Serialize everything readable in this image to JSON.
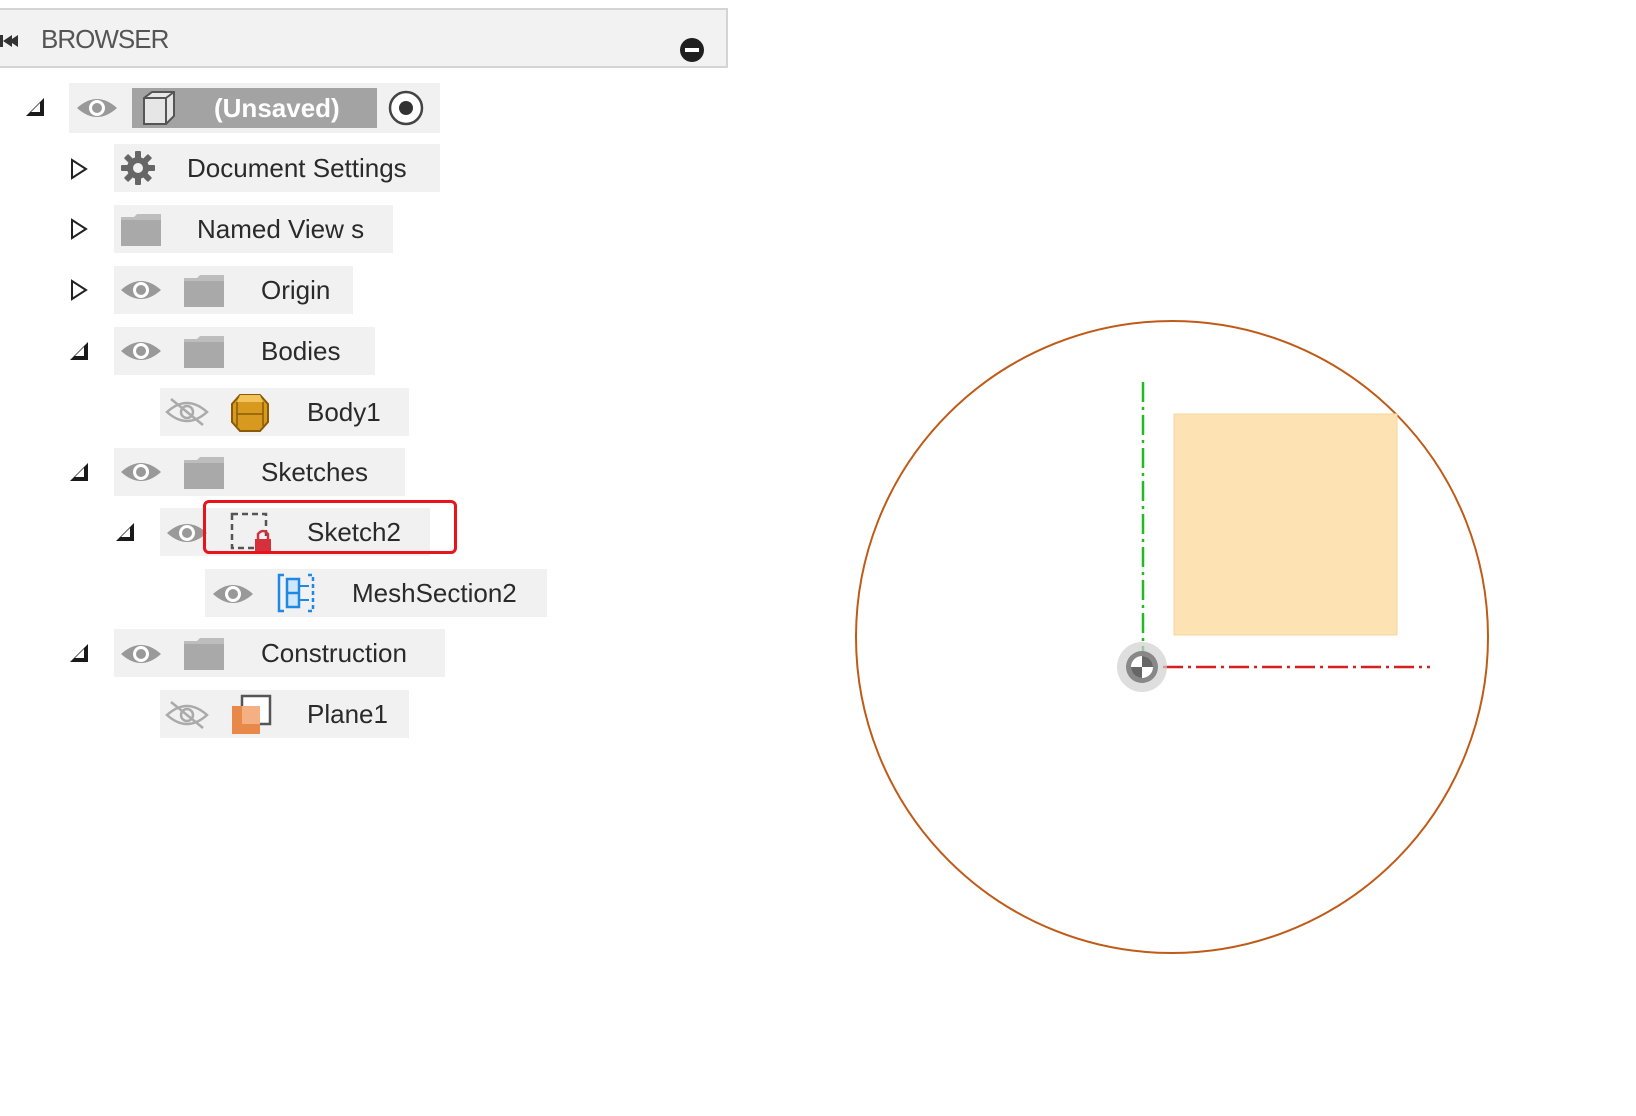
{
  "browser": {
    "title": "BROWSER",
    "collapse_icon": "collapse-left-icon",
    "minimize_icon": "minimize-icon"
  },
  "tree": {
    "root": {
      "label": "(Unsaved)",
      "icon": "component-icon",
      "activate_icon": "radio-active-icon"
    },
    "document_settings": {
      "label": "Document Settings",
      "icon": "gear-icon"
    },
    "named_views": {
      "label": "Named View s",
      "icon": "folder-icon"
    },
    "origin": {
      "label": "Origin",
      "icon": "folder-icon"
    },
    "bodies": {
      "label": "Bodies",
      "icon": "folder-icon"
    },
    "body1": {
      "label": "Body1",
      "icon": "body-icon",
      "visible": false
    },
    "sketches": {
      "label": "Sketches",
      "icon": "folder-icon"
    },
    "sketch2": {
      "label": "Sketch2",
      "icon": "sketch-locked-icon",
      "highlighted": true
    },
    "mesh_section2": {
      "label": "MeshSection2",
      "icon": "mesh-section-icon"
    },
    "construction": {
      "label": "Construction",
      "icon": "folder-icon"
    },
    "plane1": {
      "label": "Plane1",
      "icon": "plane-icon",
      "visible": false
    }
  },
  "colors": {
    "circle": "#c05a17",
    "rectangle_fill": "#fde3b3",
    "y_axis": "#22bb22",
    "x_axis": "#d42020",
    "highlight": "#e8131b"
  }
}
